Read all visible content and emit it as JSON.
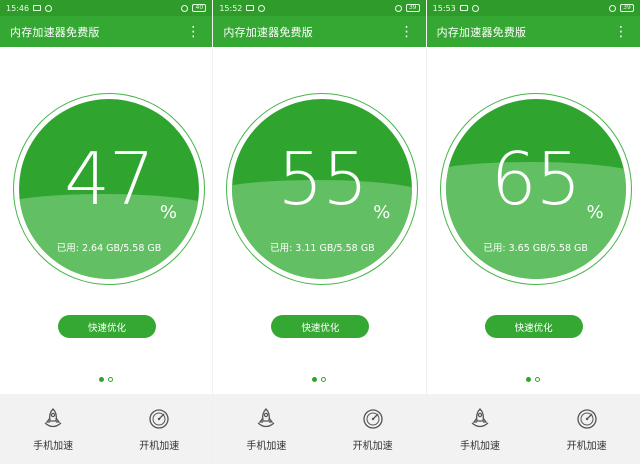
{
  "app": {
    "title": "内存加速器免费版",
    "menu_icon": "more-vert-icon",
    "colors": {
      "primary": "#35a833",
      "status_bar": "#2f9b2b",
      "gauge_dark": "#2fa52f",
      "gauge_light": "#63bf63",
      "background": "#ffffff",
      "bottom_nav_bg": "#f2f2f2"
    }
  },
  "panels": [
    {
      "status": {
        "time": "15:46",
        "battery": "40"
      },
      "gauge": {
        "percent_value": "47",
        "percent_sign": "%",
        "used_text": "已用: 2.64 GB/5.58 GB",
        "fill_fraction": 0.47
      },
      "button": {
        "label": "快速优化"
      },
      "pager": {
        "active_index": 0,
        "count": 2
      },
      "bottom_nav": [
        {
          "label": "手机加速",
          "icon": "rocket-icon"
        },
        {
          "label": "开机加速",
          "icon": "speedometer-icon"
        }
      ]
    },
    {
      "status": {
        "time": "15:52",
        "battery": "39"
      },
      "gauge": {
        "percent_value": "55",
        "percent_sign": "%",
        "used_text": "已用: 3.11 GB/5.58 GB",
        "fill_fraction": 0.55
      },
      "button": {
        "label": "快速优化"
      },
      "pager": {
        "active_index": 0,
        "count": 2
      },
      "bottom_nav": [
        {
          "label": "手机加速",
          "icon": "rocket-icon"
        },
        {
          "label": "开机加速",
          "icon": "speedometer-icon"
        }
      ]
    },
    {
      "status": {
        "time": "15:53",
        "battery": "39"
      },
      "gauge": {
        "percent_value": "65",
        "percent_sign": "%",
        "used_text": "已用: 3.65 GB/5.58 GB",
        "fill_fraction": 0.65
      },
      "button": {
        "label": "快速优化"
      },
      "pager": {
        "active_index": 0,
        "count": 2
      },
      "bottom_nav": [
        {
          "label": "手机加速",
          "icon": "rocket-icon"
        },
        {
          "label": "开机加速",
          "icon": "speedometer-icon"
        }
      ]
    }
  ]
}
